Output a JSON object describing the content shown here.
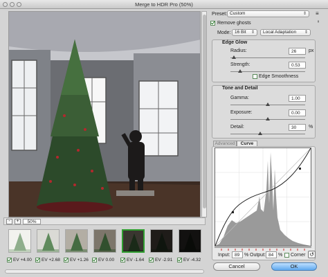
{
  "window": {
    "title": "Merge to HDR Pro (50%)"
  },
  "preview": {
    "zoom": "50%",
    "minus": "-",
    "plus": "+"
  },
  "thumbnails": [
    {
      "caption": "EV +4.00",
      "checked": true,
      "selected": false,
      "bg": "#f2f2ee",
      "fg": "#8fae8c"
    },
    {
      "caption": "EV +2.68",
      "checked": true,
      "selected": false,
      "bg": "#dadad5",
      "fg": "#5f8a5c"
    },
    {
      "caption": "EV +1.26",
      "checked": true,
      "selected": false,
      "bg": "#b3aea4",
      "fg": "#456c42"
    },
    {
      "caption": "EV 0.00",
      "checked": true,
      "selected": false,
      "bg": "#7d766b",
      "fg": "#31502e"
    },
    {
      "caption": "EV -1.64",
      "checked": true,
      "selected": true,
      "bg": "#3a3630",
      "fg": "#1a2a18"
    },
    {
      "caption": "EV -2.91",
      "checked": true,
      "selected": false,
      "bg": "#1f1c19",
      "fg": "#0f150e"
    },
    {
      "caption": "EV -4.32",
      "checked": true,
      "selected": false,
      "bg": "#121110",
      "fg": "#090b08"
    }
  ],
  "controls": {
    "preset_label": "Preset:",
    "preset_value": "Custom",
    "remove_ghosts": "Remove ghosts",
    "remove_ghosts_checked": true,
    "mode_label": "Mode:",
    "bit_depth": "16 Bit",
    "method": "Local Adaptation",
    "edge_glow": {
      "title": "Edge Glow",
      "radius_label": "Radius:",
      "radius_value": "26",
      "radius_unit": "px",
      "radius_level": 0.05,
      "strength_label": "Strength:",
      "strength_value": "0.53",
      "strength_level": 0.13,
      "edge_smoothness": "Edge Smoothness",
      "edge_smoothness_checked": false
    },
    "tone_detail": {
      "title": "Tone and Detail",
      "gamma_label": "Gamma:",
      "gamma_value": "1.00",
      "gamma_level": 0.5,
      "exposure_label": "Exposure:",
      "exposure_value": "0.00",
      "exposure_level": 0.5,
      "detail_label": "Detail:",
      "detail_value": "30",
      "detail_unit": "%",
      "detail_level": 0.4
    },
    "tabs": {
      "advanced": "Advanced",
      "curve": "Curve"
    },
    "curve": {
      "input_label": "Input:",
      "input_value": "89",
      "input_unit": "%",
      "output_label": "Output:",
      "output_value": "84",
      "output_unit": "%",
      "corner": "Corner",
      "corner_checked": false
    },
    "cancel": "Cancel",
    "ok": "OK"
  }
}
